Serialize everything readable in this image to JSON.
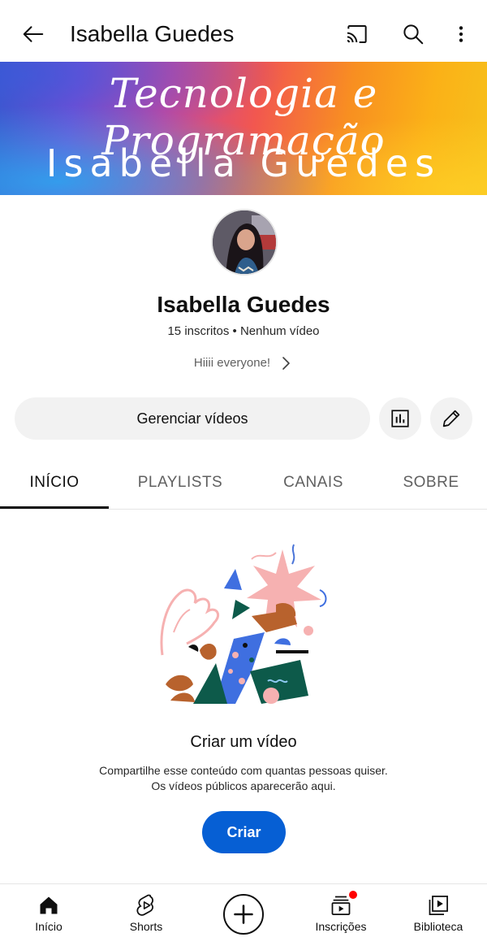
{
  "header": {
    "title": "Isabella Guedes",
    "icons": {
      "back": "arrow-back-icon",
      "cast": "cast-icon",
      "search": "search-icon",
      "more": "more-vert-icon"
    }
  },
  "banner": {
    "subtitle": "Tecnologia e Programação",
    "title": "Isabella Guedes"
  },
  "channel": {
    "name": "Isabella Guedes",
    "subscribers": "15 inscritos",
    "separator": "•",
    "videos": "Nenhum vídeo",
    "description": "Hiiii everyone!"
  },
  "actions": {
    "manage_label": "Gerenciar vídeos",
    "analytics_icon": "analytics-icon",
    "edit_icon": "edit-pencil-icon"
  },
  "tabs": [
    {
      "label": "INÍCIO",
      "active": true
    },
    {
      "label": "PLAYLISTS",
      "active": false
    },
    {
      "label": "CANAIS",
      "active": false
    },
    {
      "label": "SOBRE",
      "active": false
    }
  ],
  "empty_state": {
    "title": "Criar um vídeo",
    "line1": "Compartilhe esse conteúdo com quantas pessoas quiser.",
    "line2": "Os vídeos públicos aparecerão aqui.",
    "button": "Criar"
  },
  "bottom_nav": [
    {
      "label": "Início",
      "icon": "home-icon"
    },
    {
      "label": "Shorts",
      "icon": "shorts-icon"
    },
    {
      "label": "",
      "icon": "create-plus-icon"
    },
    {
      "label": "Inscrições",
      "icon": "subscriptions-icon",
      "notification": true
    },
    {
      "label": "Biblioteca",
      "icon": "library-icon"
    }
  ],
  "colors": {
    "accent_blue": "#065fd4",
    "notification_red": "#ff0000",
    "chip_gray": "#f2f2f2"
  }
}
